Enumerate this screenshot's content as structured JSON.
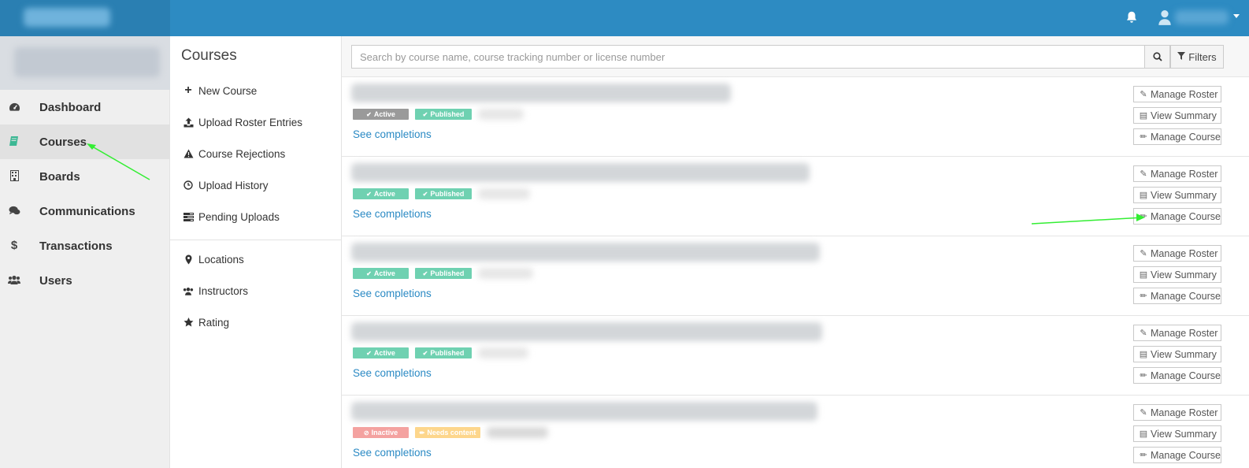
{
  "colors": {
    "topbar": "#2d8bc2",
    "accent_link": "#2b8ac4",
    "badge_green": "#6fd1b1",
    "badge_gray": "#9a9a9a",
    "badge_red": "#f4a2a0",
    "badge_orange": "#fdd68c",
    "annotation_arrow": "#33ee33"
  },
  "topbar": {
    "bell_icon": "bell-icon",
    "user_icon": "user-icon"
  },
  "sidebar": {
    "items": [
      {
        "label": "Dashboard",
        "icon": "dashboard-icon"
      },
      {
        "label": "Courses",
        "icon": "book-icon",
        "active": true
      },
      {
        "label": "Boards",
        "icon": "building-icon"
      },
      {
        "label": "Communications",
        "icon": "comments-icon"
      },
      {
        "label": "Transactions",
        "icon": "dollar-icon"
      },
      {
        "label": "Users",
        "icon": "users-icon"
      }
    ]
  },
  "subnav": {
    "title": "Courses",
    "items": [
      {
        "label": "New Course",
        "icon": "plus-icon"
      },
      {
        "label": "Upload Roster Entries",
        "icon": "upload-icon"
      },
      {
        "label": "Course Rejections",
        "icon": "warning-icon"
      },
      {
        "label": "Upload History",
        "icon": "clock-icon"
      },
      {
        "label": "Pending Uploads",
        "icon": "tasks-icon"
      }
    ],
    "items2": [
      {
        "label": "Locations",
        "icon": "map-marker-icon"
      },
      {
        "label": "Instructors",
        "icon": "users-icon"
      },
      {
        "label": "Rating",
        "icon": "star-icon"
      }
    ]
  },
  "search": {
    "placeholder": "Search by course name, course tracking number or license number",
    "filters_label": "Filters"
  },
  "courses": [
    {
      "status": "Active",
      "status_style": "gray",
      "state": "Published"
    },
    {
      "status": "Active",
      "status_style": "green",
      "state": "Published"
    },
    {
      "status": "Active",
      "status_style": "green",
      "state": "Published"
    },
    {
      "status": "Active",
      "status_style": "green",
      "state": "Published"
    },
    {
      "status": "Inactive",
      "status_style": "red",
      "state": "Needs content"
    }
  ],
  "row_labels": {
    "see_completions": "See completions",
    "manage_roster": "Manage Roster",
    "view_summary": "View Summary",
    "manage_course": "Manage Course"
  }
}
